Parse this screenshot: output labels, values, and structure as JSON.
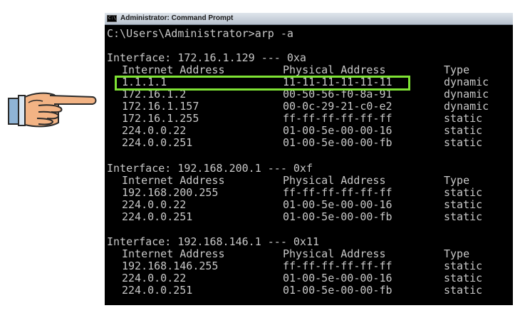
{
  "window": {
    "title": "Administrator: Command Prompt",
    "icon": "cmd-icon"
  },
  "pointer_icon": "pointing-hand-icon",
  "highlight_color": "#7ee234",
  "console": {
    "command_line": "C:\\Users\\Administrator>arp -a",
    "interfaces": [
      {
        "header": "Interface: 172.16.1.129 --- 0xa",
        "columns": [
          "Internet Address",
          "Physical Address",
          "Type"
        ],
        "rows": [
          [
            "1.1.1.1",
            "11-11-11-11-11-11",
            "dynamic"
          ],
          [
            "172.16.1.2",
            "00-50-56-f0-8a-91",
            "dynamic"
          ],
          [
            "172.16.1.157",
            "00-0c-29-21-c0-e2",
            "dynamic"
          ],
          [
            "172.16.1.255",
            "ff-ff-ff-ff-ff-ff",
            "static"
          ],
          [
            "224.0.0.22",
            "01-00-5e-00-00-16",
            "static"
          ],
          [
            "224.0.0.251",
            "01-00-5e-00-00-fb",
            "static"
          ]
        ]
      },
      {
        "header": "Interface: 192.168.200.1 --- 0xf",
        "columns": [
          "Internet Address",
          "Physical Address",
          "Type"
        ],
        "rows": [
          [
            "192.168.200.255",
            "ff-ff-ff-ff-ff-ff",
            "static"
          ],
          [
            "224.0.0.22",
            "01-00-5e-00-00-16",
            "static"
          ],
          [
            "224.0.0.251",
            "01-00-5e-00-00-fb",
            "static"
          ]
        ]
      },
      {
        "header": "Interface: 192.168.146.1 --- 0x11",
        "columns": [
          "Internet Address",
          "Physical Address",
          "Type"
        ],
        "rows": [
          [
            "192.168.146.255",
            "ff-ff-ff-ff-ff-ff",
            "static"
          ],
          [
            "224.0.0.22",
            "01-00-5e-00-00-16",
            "static"
          ],
          [
            "224.0.0.251",
            "01-00-5e-00-00-fb",
            "static"
          ]
        ]
      }
    ]
  }
}
